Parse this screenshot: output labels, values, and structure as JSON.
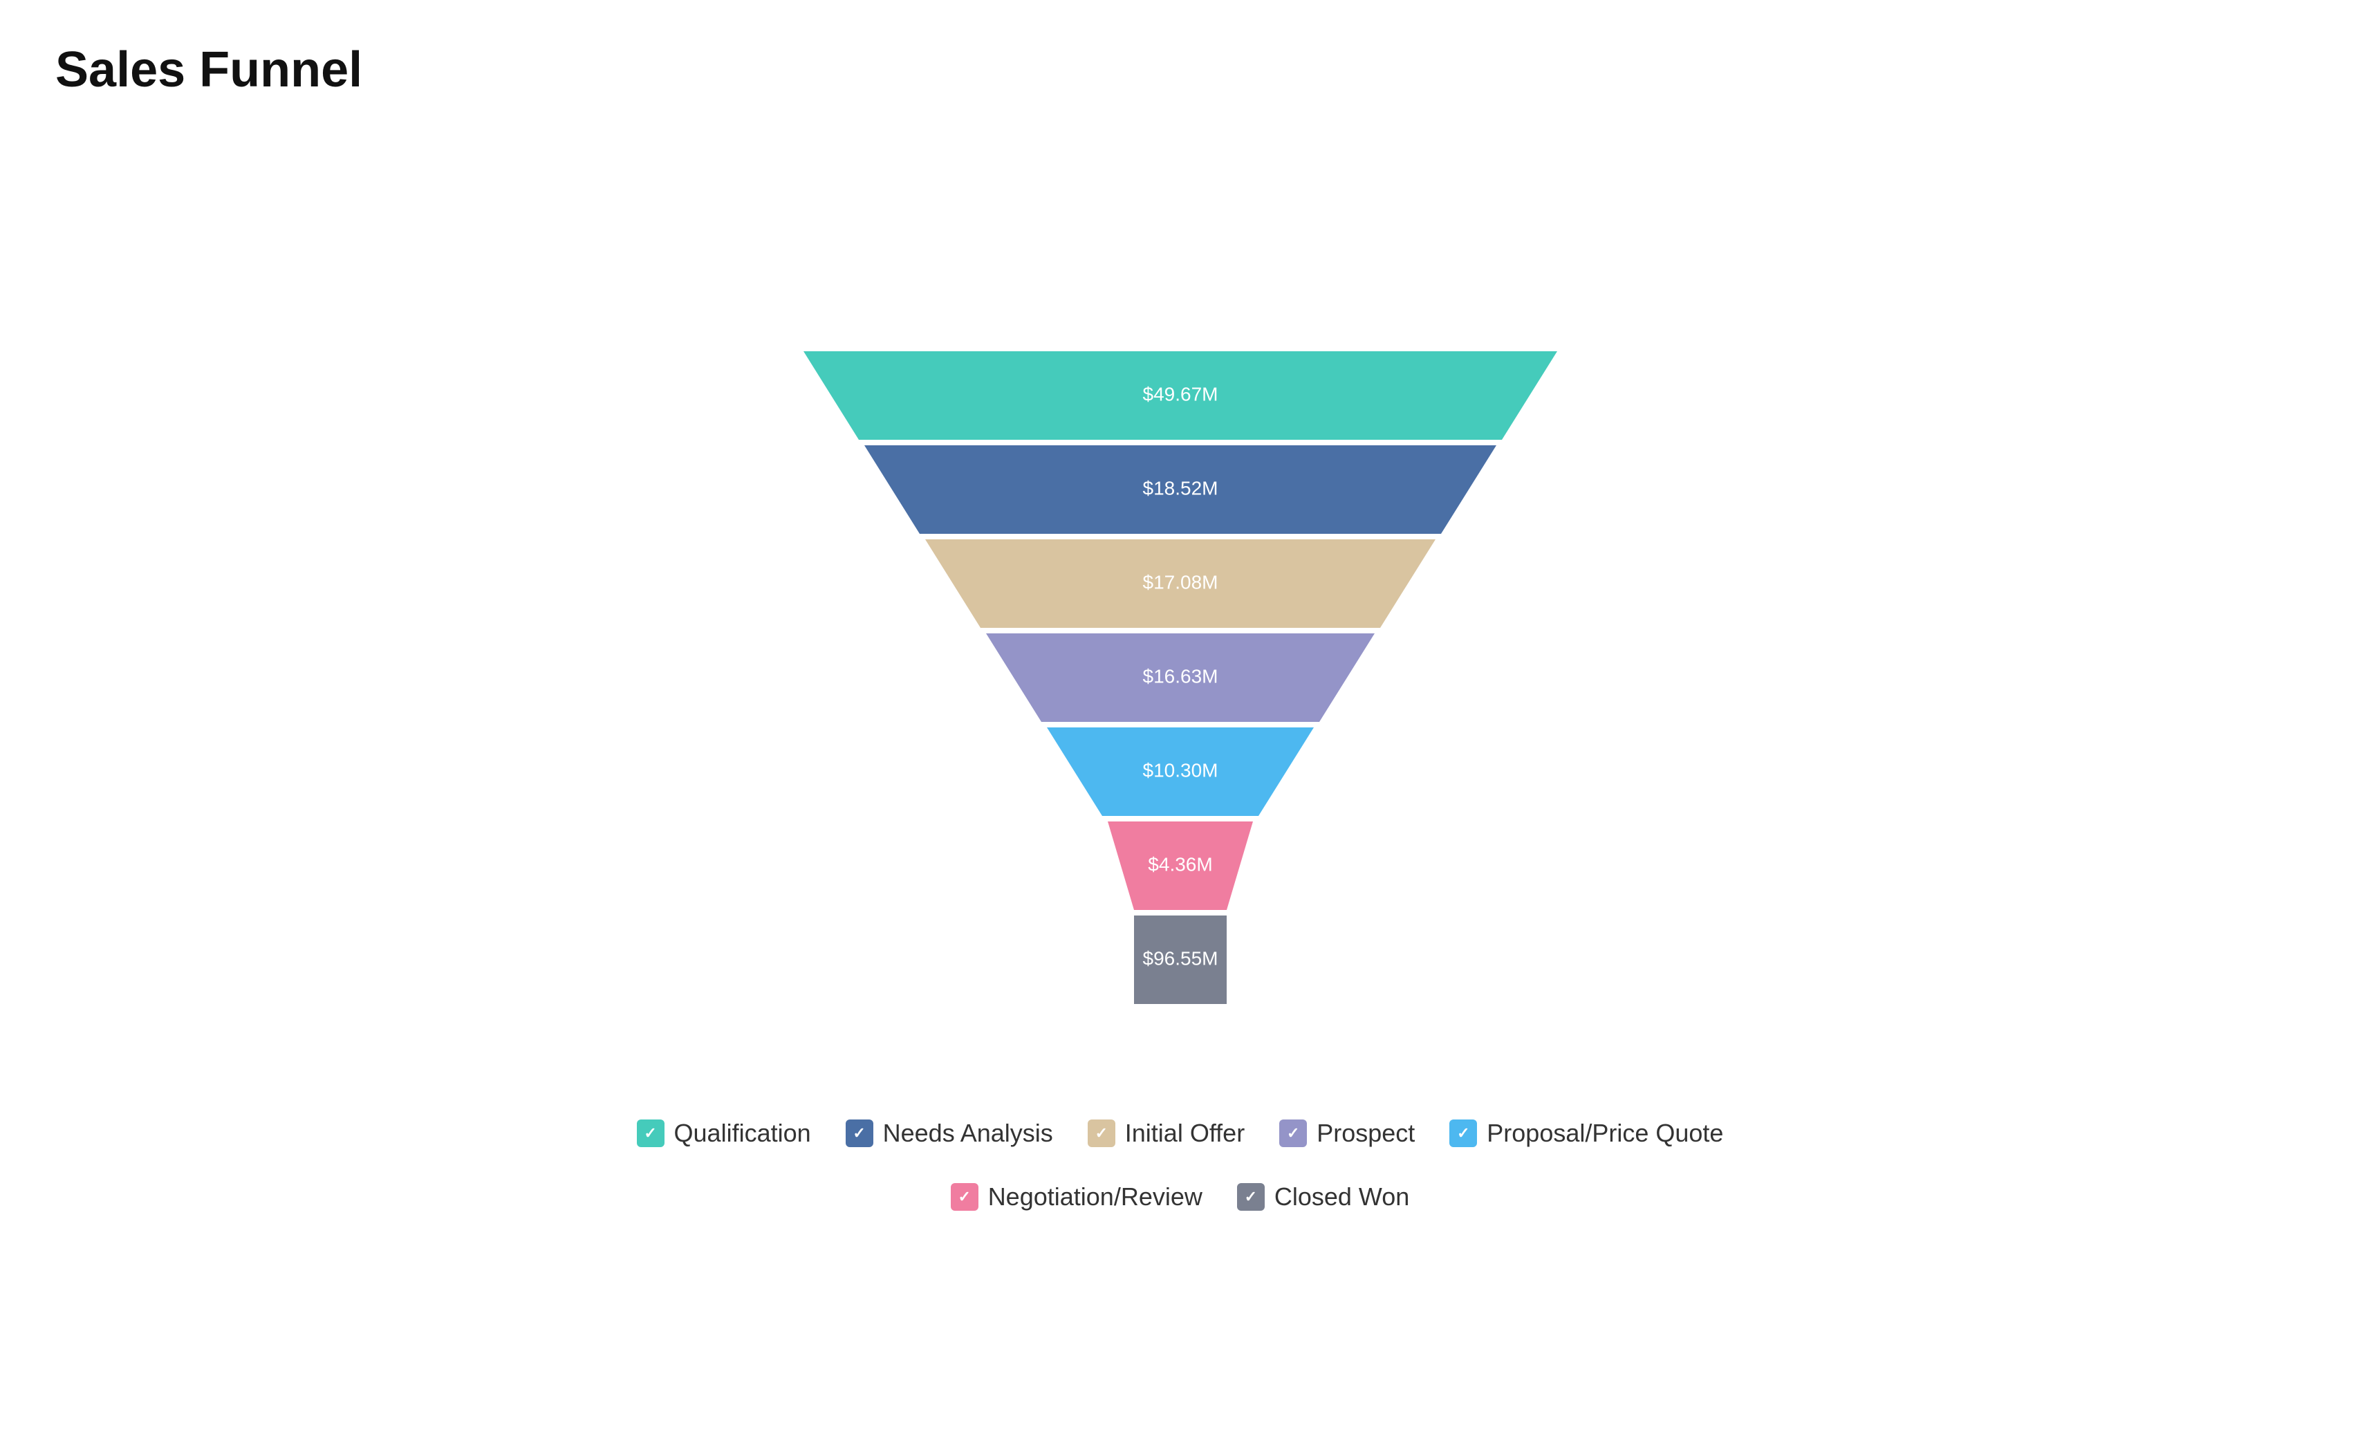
{
  "title": "Sales Funnel",
  "funnel": {
    "segments": [
      {
        "id": "qualification",
        "label": "$49.67M",
        "color": "#45CBBB",
        "leftPct": 0.12,
        "rightPct": 0.88,
        "topY": 0,
        "bottomY": 140
      },
      {
        "id": "needs-analysis",
        "label": "$18.52M",
        "color": "#4A6FA5",
        "leftPct": 0.185,
        "rightPct": 0.815,
        "topY": 148,
        "bottomY": 288
      },
      {
        "id": "initial-offer",
        "label": "$17.08M",
        "color": "#D9C4A0",
        "leftPct": 0.255,
        "rightPct": 0.745,
        "topY": 296,
        "bottomY": 436
      },
      {
        "id": "prospect",
        "label": "$16.63M",
        "color": "#9494C8",
        "leftPct": 0.325,
        "rightPct": 0.675,
        "topY": 444,
        "bottomY": 584
      },
      {
        "id": "proposal-price-quote",
        "label": "$10.30M",
        "color": "#4DB8F0",
        "leftPct": 0.395,
        "rightPct": 0.605,
        "topY": 592,
        "bottomY": 732
      },
      {
        "id": "negotiation-review",
        "label": "$4.36M",
        "color": "#F07DA0",
        "leftPct": 0.455,
        "rightPct": 0.545,
        "topY": 740,
        "bottomY": 860
      },
      {
        "id": "closed-won",
        "label": "$96.55M",
        "color": "#7A8090",
        "leftPct": 0.455,
        "rightPct": 0.545,
        "topY": 868,
        "bottomY": 988
      }
    ]
  },
  "legend": {
    "items": [
      {
        "id": "qualification",
        "label": "Qualification",
        "color": "#45CBBB"
      },
      {
        "id": "needs-analysis",
        "label": "Needs Analysis",
        "color": "#4A6FA5"
      },
      {
        "id": "initial-offer",
        "label": "Initial Offer",
        "color": "#D9C4A0"
      },
      {
        "id": "prospect",
        "label": "Prospect",
        "color": "#9494C8"
      },
      {
        "id": "proposal-price-quote",
        "label": "Proposal/Price Quote",
        "color": "#4DB8F0"
      },
      {
        "id": "negotiation-review",
        "label": "Negotiation/Review",
        "color": "#F07DA0"
      },
      {
        "id": "closed-won",
        "label": "Closed Won",
        "color": "#7A8090"
      }
    ]
  }
}
